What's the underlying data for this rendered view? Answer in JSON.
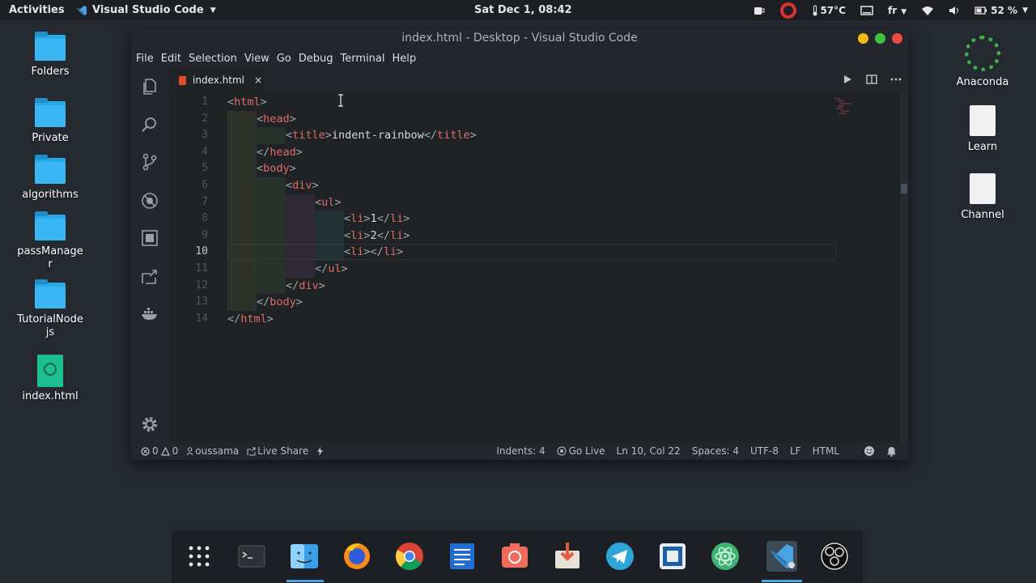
{
  "topbar": {
    "activities": "Activities",
    "app_name": "Visual Studio Code",
    "clock": "Sat Dec  1, 08:42",
    "temperature": "57°C",
    "keyboard_layout": "fr",
    "battery": "52 %"
  },
  "desktop": {
    "left_icons": [
      "Folders",
      "Private",
      "algorithms",
      "passManager",
      "TutorialNodejs",
      "index.html"
    ],
    "right_icons": [
      "Anaconda",
      "Learn",
      "Channel"
    ]
  },
  "window": {
    "title": "index.html - Desktop - Visual Studio Code",
    "menu": [
      "File",
      "Edit",
      "Selection",
      "View",
      "Go",
      "Debug",
      "Terminal",
      "Help"
    ],
    "tab_label": "index.html",
    "tab_close": "×",
    "code_lines": [
      {
        "n": "1",
        "text": "<html>"
      },
      {
        "n": "2",
        "text": "<head>"
      },
      {
        "n": "3",
        "text": "<title>indent-rainbow</title>"
      },
      {
        "n": "4",
        "text": "</head>"
      },
      {
        "n": "5",
        "text": "<body>"
      },
      {
        "n": "6",
        "text": "<div>"
      },
      {
        "n": "7",
        "text": "<ul>"
      },
      {
        "n": "8",
        "text": "<li>1</li>"
      },
      {
        "n": "9",
        "text": "<li>2</li>"
      },
      {
        "n": "10",
        "text": "<li></li>"
      },
      {
        "n": "11",
        "text": "</ul>"
      },
      {
        "n": "12",
        "text": "</div>"
      },
      {
        "n": "13",
        "text": "</body>"
      },
      {
        "n": "14",
        "text": "</html>"
      }
    ],
    "status": {
      "errors": "0",
      "warnings": "0",
      "user": "oussama",
      "live_share": "Live Share",
      "indents": "Indents: 4",
      "go_live": "Go Live",
      "position": "Ln 10, Col 22",
      "spaces": "Spaces: 4",
      "encoding": "UTF-8",
      "eol": "LF",
      "language": "HTML"
    }
  },
  "colors": {
    "tag": "#e26b67",
    "bracket": "#a1a6ab",
    "accent": "#4aa3e0",
    "folder": "#3bb6f4"
  }
}
